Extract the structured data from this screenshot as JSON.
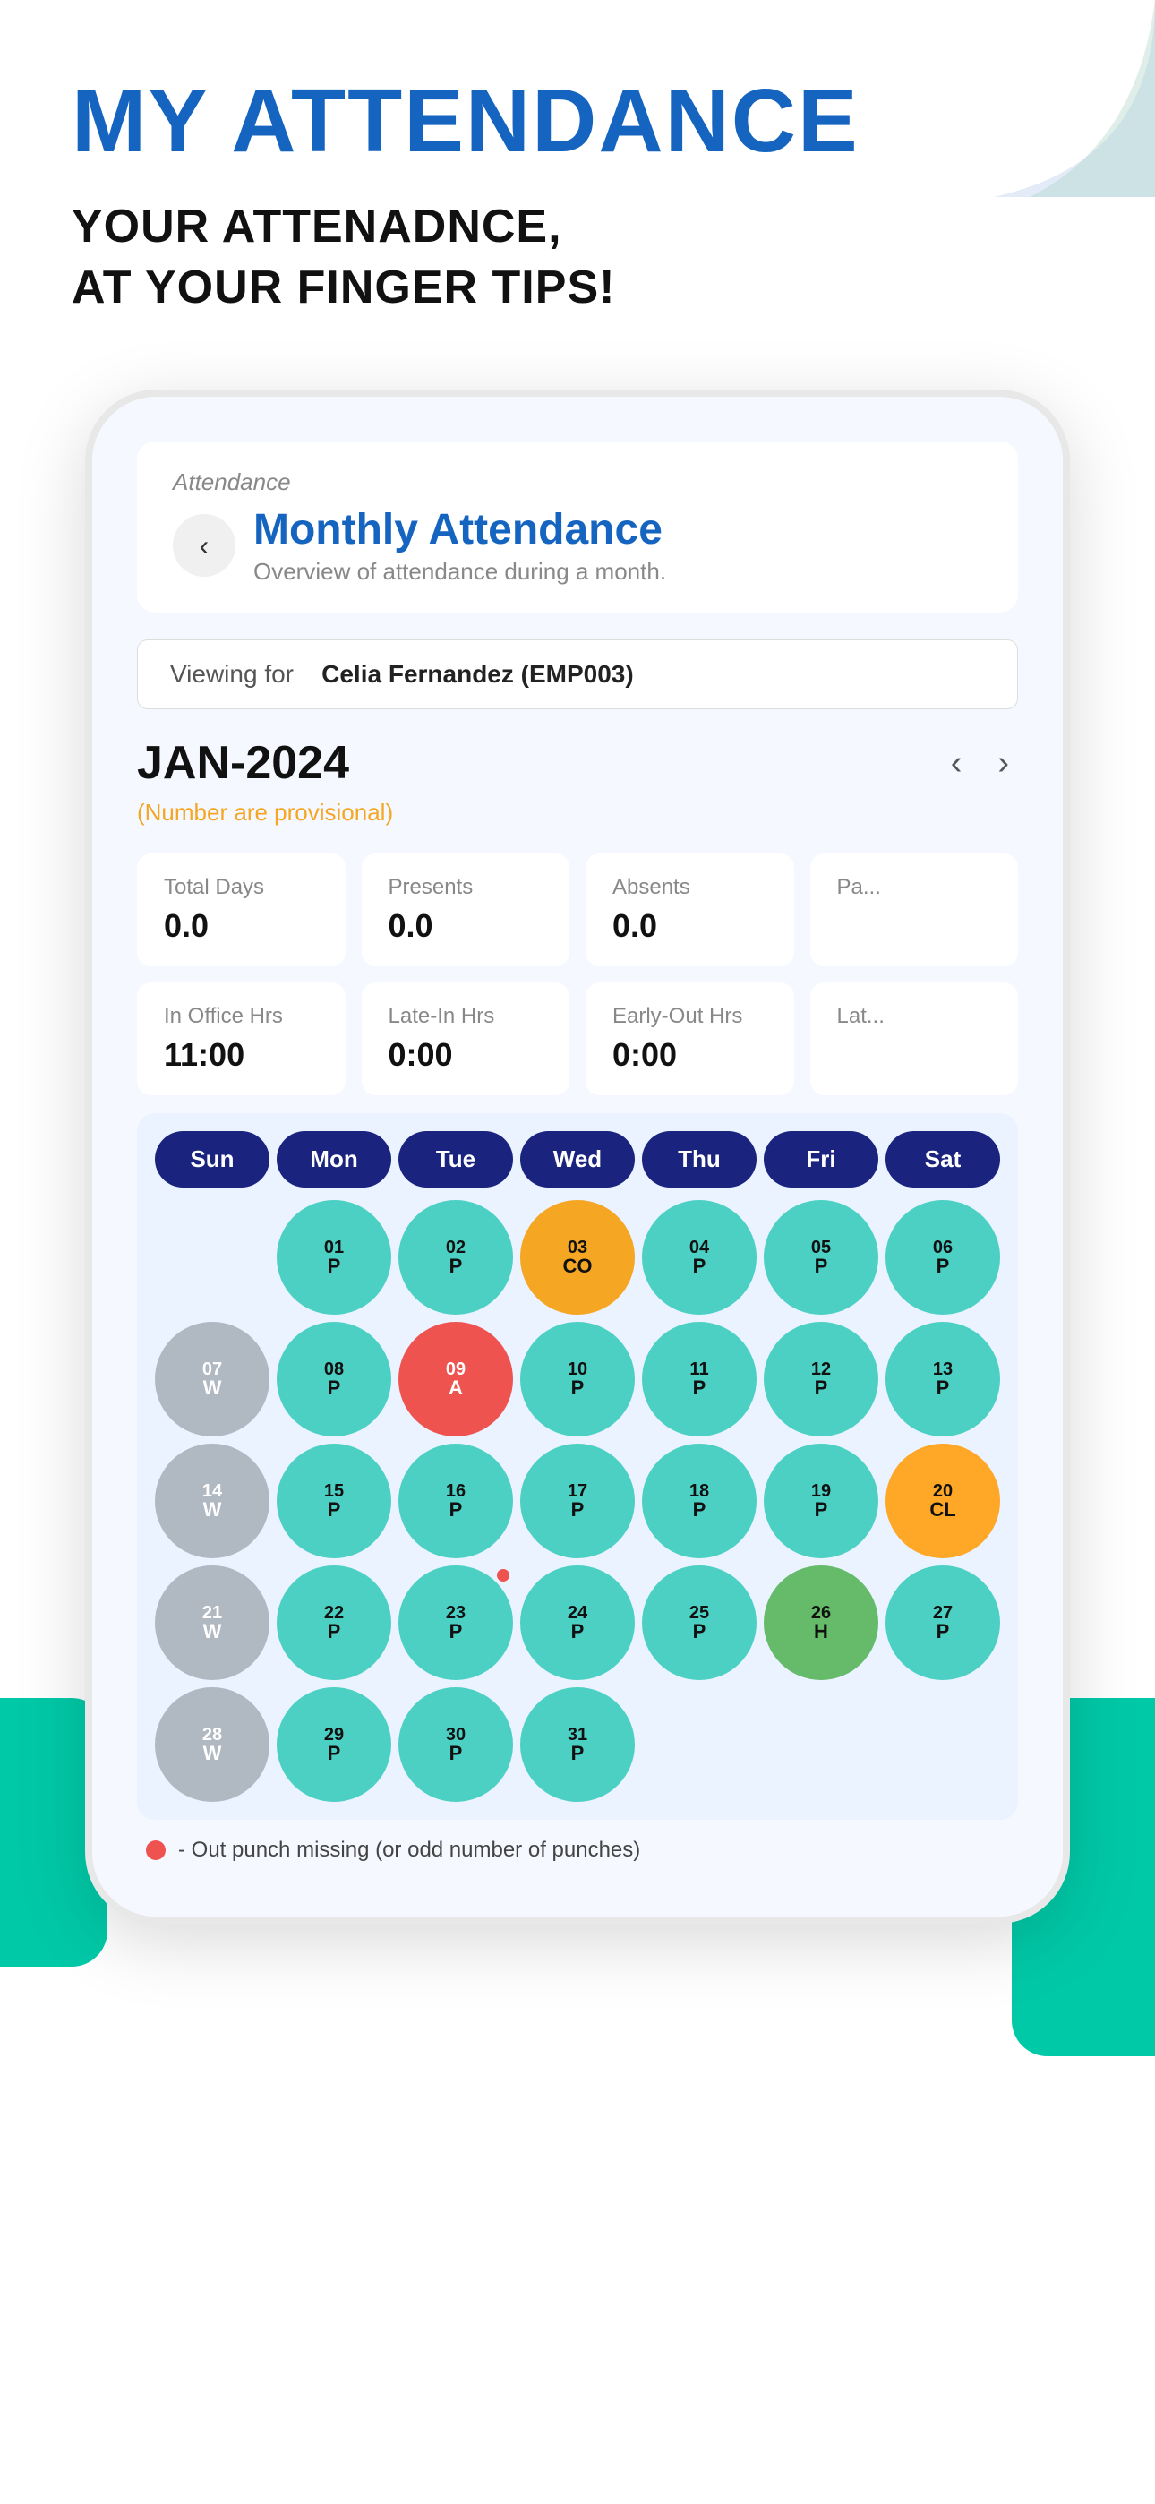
{
  "header": {
    "main_title": "MY ATTENDANCE",
    "subtitle_line1": "YOUR ATTENADNCE,",
    "subtitle_line2": "AT YOUR FINGER TIPS!"
  },
  "app": {
    "breadcrumb": "Attendance",
    "page_title": "Monthly Attendance",
    "page_subtitle": "Overview of attendance during a month.",
    "back_button_label": "‹",
    "viewing_for_label": "Viewing for",
    "viewing_for_employee": "Celia Fernandez (EMP003)",
    "month_label": "JAN-2024",
    "provisional_note": "(Number are provisional)",
    "nav_prev": "‹",
    "nav_next": "›"
  },
  "stats": [
    {
      "label": "Total Days",
      "value": "0.0"
    },
    {
      "label": "Presents",
      "value": "0.0"
    },
    {
      "label": "Absents",
      "value": "0.0"
    },
    {
      "label": "Pa...",
      "value": ""
    }
  ],
  "stats2": [
    {
      "label": "In Office Hrs",
      "value": "11:00"
    },
    {
      "label": "Late-In Hrs",
      "value": "0:00"
    },
    {
      "label": "Early-Out Hrs",
      "value": "0:00"
    },
    {
      "label": "Lat...",
      "value": ""
    }
  ],
  "calendar": {
    "days_of_week": [
      "Sun",
      "Mon",
      "Tue",
      "Wed",
      "Thu",
      "Fri",
      "Sat"
    ],
    "weeks": [
      [
        {
          "num": "",
          "status": "",
          "type": "empty"
        },
        {
          "num": "01",
          "status": "P",
          "type": "p"
        },
        {
          "num": "02",
          "status": "P",
          "type": "p"
        },
        {
          "num": "03",
          "status": "CO",
          "type": "co"
        },
        {
          "num": "04",
          "status": "P",
          "type": "p"
        },
        {
          "num": "05",
          "status": "P",
          "type": "p"
        },
        {
          "num": "06",
          "status": "P",
          "type": "p"
        }
      ],
      [
        {
          "num": "07",
          "status": "W",
          "type": "w"
        },
        {
          "num": "08",
          "status": "P",
          "type": "p"
        },
        {
          "num": "09",
          "status": "A",
          "type": "a"
        },
        {
          "num": "10",
          "status": "P",
          "type": "p"
        },
        {
          "num": "11",
          "status": "P",
          "type": "p"
        },
        {
          "num": "12",
          "status": "P",
          "type": "p"
        },
        {
          "num": "13",
          "status": "P",
          "type": "p"
        }
      ],
      [
        {
          "num": "14",
          "status": "W",
          "type": "w"
        },
        {
          "num": "15",
          "status": "P",
          "type": "p"
        },
        {
          "num": "16",
          "status": "P",
          "type": "p"
        },
        {
          "num": "17",
          "status": "P",
          "type": "p"
        },
        {
          "num": "18",
          "status": "P",
          "type": "p"
        },
        {
          "num": "19",
          "status": "P",
          "type": "p"
        },
        {
          "num": "20",
          "status": "CL",
          "type": "cl"
        }
      ],
      [
        {
          "num": "21",
          "status": "W",
          "type": "w"
        },
        {
          "num": "22",
          "status": "P",
          "type": "p"
        },
        {
          "num": "23",
          "status": "P",
          "type": "p",
          "dot": true
        },
        {
          "num": "24",
          "status": "P",
          "type": "p"
        },
        {
          "num": "25",
          "status": "P",
          "type": "p"
        },
        {
          "num": "26",
          "status": "H",
          "type": "h"
        },
        {
          "num": "27",
          "status": "P",
          "type": "p"
        }
      ],
      [
        {
          "num": "28",
          "status": "W",
          "type": "w"
        },
        {
          "num": "29",
          "status": "P",
          "type": "p"
        },
        {
          "num": "30",
          "status": "P",
          "type": "p"
        },
        {
          "num": "31",
          "status": "P",
          "type": "p"
        },
        {
          "num": "",
          "status": "",
          "type": "empty"
        },
        {
          "num": "",
          "status": "",
          "type": "empty"
        },
        {
          "num": "",
          "status": "",
          "type": "empty"
        }
      ]
    ]
  },
  "legend": {
    "text": "- Out punch missing (or odd number of punches)"
  }
}
